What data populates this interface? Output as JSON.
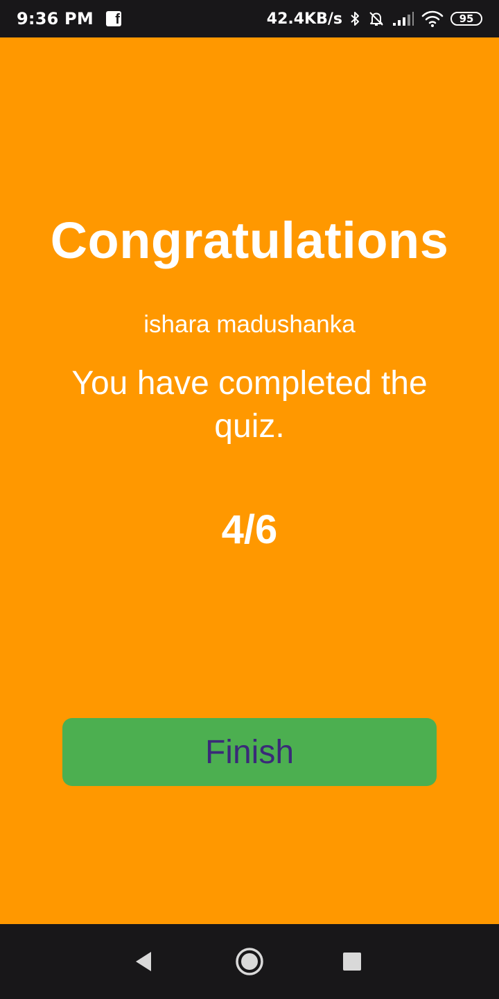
{
  "status_bar": {
    "time": "9:36 PM",
    "app_icon": "facebook-icon",
    "network_speed": "42.4KB/s",
    "icons": [
      "bluetooth-icon",
      "notifications-off-icon",
      "signal-icon",
      "wifi-icon"
    ],
    "battery_level": "95"
  },
  "screen": {
    "title": "Congratulations",
    "user_name": "ishara madushanka",
    "message": "You have completed the quiz.",
    "score": "4/6",
    "finish_label": "Finish"
  },
  "nav_bar": {
    "buttons": [
      "back-icon",
      "home-icon",
      "recents-icon"
    ]
  },
  "colors": {
    "background": "#FF9800",
    "button": "#4CAF50",
    "button_text": "#3A2A78",
    "system_bars": "#181719",
    "text": "#FFFFFF"
  }
}
